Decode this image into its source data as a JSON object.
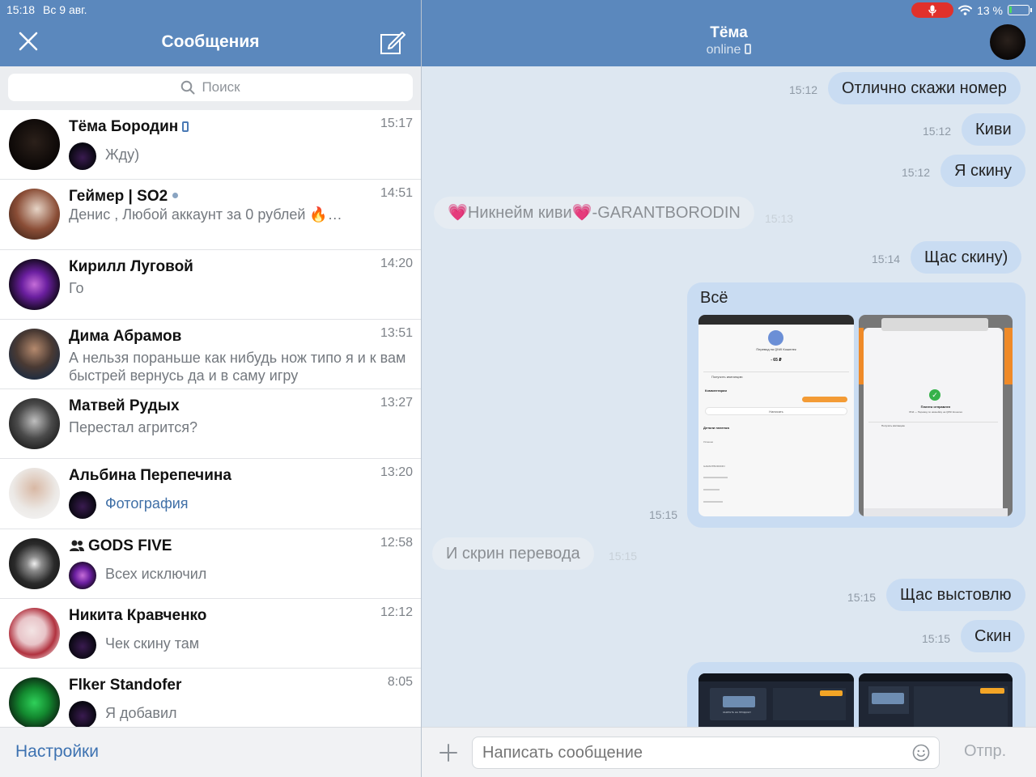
{
  "status_bar": {
    "time": "15:18",
    "date": "Вс 9 авг.",
    "battery": "13 %",
    "battery_level": 0.13
  },
  "left": {
    "title": "Сообщения",
    "search_placeholder": "Поиск",
    "settings_label": "Настройки"
  },
  "chats": [
    {
      "name": "Тёма Бородин",
      "time": "15:17",
      "preview": "Жду)",
      "mini_avatar": true,
      "phone": true
    },
    {
      "name": "Геймер | SO2",
      "time": "14:51",
      "preview": "Денис , Любой аккаунт за 0 рублей  🔥…",
      "mini_avatar": false,
      "online": true
    },
    {
      "name": "Кирилл Луговой",
      "time": "14:20",
      "preview": "Го",
      "mini_avatar": false
    },
    {
      "name": "Дима Абрамов",
      "time": "13:51",
      "preview": "А нельзя пораньше как нибудь нож типо я и к вам быстрей вернусь да и в саму игру",
      "mini_avatar": false
    },
    {
      "name": "Матвей Рудых",
      "time": "13:27",
      "preview": "Перестал агрится?",
      "mini_avatar": false
    },
    {
      "name": "Альбина Перепечина",
      "time": "13:20",
      "preview": "Фотография",
      "mini_avatar": true,
      "link": true
    },
    {
      "name": "GODS FIVE",
      "time": "12:58",
      "preview": "Всех исключил",
      "mini_avatar": true,
      "group": true
    },
    {
      "name": "Никита Кравченко",
      "time": "12:12",
      "preview": "Чек скину там",
      "mini_avatar": true
    },
    {
      "name": "Flker Standofer",
      "time": "8:05",
      "preview": "Я добавил",
      "mini_avatar": true
    }
  ],
  "peer": {
    "name": "Тёма",
    "status": "online"
  },
  "messages": [
    {
      "dir": "out",
      "text": "Отлично скажи номер",
      "time": "15:12"
    },
    {
      "dir": "out",
      "text": "Киви",
      "time": "15:12"
    },
    {
      "dir": "out",
      "text": "Я скину",
      "time": "15:12"
    },
    {
      "dir": "in",
      "text": "💗Никнейм киви💗-GARANTBORODIN",
      "time": "15:13"
    },
    {
      "dir": "out",
      "text": "Щас скину)",
      "time": "15:14"
    },
    {
      "dir": "out",
      "text": "Всё",
      "time": "15:15",
      "photos": 2
    },
    {
      "dir": "in",
      "text": "И скрин перевода",
      "time": "15:15"
    },
    {
      "dir": "out",
      "text": "Щас выстовлю",
      "time": "15:15"
    },
    {
      "dir": "out",
      "text": "Скин",
      "time": "15:15"
    }
  ],
  "screenshot_text": {
    "transfer_title": "Перевод на QIWI Кошелек",
    "amount": "- 65 ₽",
    "receipt": "Получить квитанцию",
    "comment": "Комментарии",
    "write": "Написать",
    "details": "Детали платежа",
    "status": "Успешно",
    "recipient": "GARANTBORODIN",
    "payment_sent": "Платеж отправлен",
    "payment_sent_sub": "65 ₽ — Перевод по никнейму на QIWI Кошелек",
    "market": "ЗАКРЫТЬ НА ПРОДАЖУ"
  },
  "composer": {
    "placeholder": "Написать сообщение",
    "send_label": "Отпр."
  },
  "colors": {
    "header": "#5b88bd",
    "bubble_out": "#c9dcf2",
    "bubble_in": "#e6ecf2",
    "accent": "#3d72b1"
  }
}
